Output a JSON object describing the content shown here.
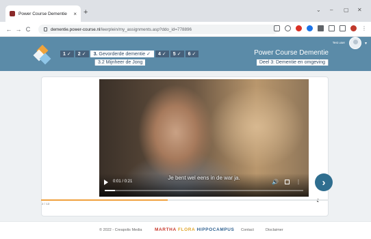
{
  "browser": {
    "tab_title": "Power Course Dementie",
    "tab_close": "×",
    "new_tab": "+",
    "url_host": "dementie.power-course.nl",
    "url_path": "/leerplein/my_assignments.asp?ddo_id=778896",
    "nav": {
      "back": "←",
      "forward": "→",
      "reload": "C"
    },
    "window": {
      "chevron": "⌄",
      "minimize": "–",
      "maximize": "▢",
      "close": "✕"
    }
  },
  "header": {
    "steps": [
      {
        "num": "1",
        "check": "✓"
      },
      {
        "num": "2",
        "check": "✓"
      },
      {
        "num": "3.",
        "label": "Gevorderde dementie",
        "check": "✓"
      },
      {
        "num": "4",
        "check": "✓"
      },
      {
        "num": "5",
        "check": "✓"
      },
      {
        "num": "6",
        "check": "✓"
      }
    ],
    "substep": "3.2 Mijnheer de Jong",
    "course_title": "Power Course Dementie",
    "course_sub": "Deel 3: Dementie en omgeving",
    "user_name": "Test user",
    "user_caret": "▾"
  },
  "video": {
    "subtitle": "Je bent wel eens in de war ja.",
    "time": "0:01 / 0:21",
    "progress": 0.05,
    "vol_symbol": "🔊",
    "more_symbol": "⋮"
  },
  "nav": {
    "next": "›",
    "prev": "‹"
  },
  "course_progress": {
    "label": "2 / 13",
    "value": 0.44
  },
  "footer": {
    "copyright": "© 2022 - Creapolis Media",
    "sponsor": [
      "MARTHA",
      "FLORA",
      "HIPPOCAMPUS"
    ],
    "contact": "Contact",
    "disclaimer": "Disclaimer"
  }
}
